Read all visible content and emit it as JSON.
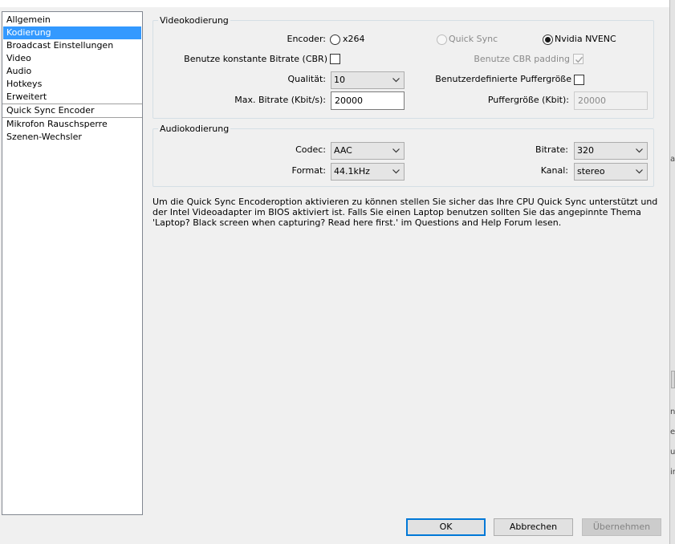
{
  "sidebar": {
    "items": [
      {
        "label": "Allgemein"
      },
      {
        "label": "Kodierung"
      },
      {
        "label": "Broadcast Einstellungen"
      },
      {
        "label": "Video"
      },
      {
        "label": "Audio"
      },
      {
        "label": "Hotkeys"
      },
      {
        "label": "Erweitert"
      },
      {
        "label": "Quick Sync Encoder"
      },
      {
        "label": "Mikrofon Rauschsperre"
      },
      {
        "label": "Szenen-Wechsler"
      }
    ],
    "selected_index": 1
  },
  "video": {
    "title": "Videokodierung",
    "encoder_label": "Encoder:",
    "encoder_options": [
      {
        "label": "x264",
        "selected": false,
        "enabled": true
      },
      {
        "label": "Quick Sync",
        "selected": false,
        "enabled": false
      },
      {
        "label": "Nvidia NVENC",
        "selected": true,
        "enabled": true
      }
    ],
    "cbr_label": "Benutze konstante Bitrate (CBR)",
    "cbr_padding_label": "Benutze CBR padding",
    "quality_label": "Qualität:",
    "quality_value": "10",
    "custom_buffer_label": "Benutzerdefinierte Puffergröße",
    "max_bitrate_label": "Max. Bitrate (Kbit/s):",
    "max_bitrate_value": "20000",
    "buffer_size_label": "Puffergröße (Kbit):",
    "buffer_size_value": "20000"
  },
  "audio": {
    "title": "Audiokodierung",
    "codec_label": "Codec:",
    "codec_value": "AAC",
    "bitrate_label": "Bitrate:",
    "bitrate_value": "320",
    "format_label": "Format:",
    "format_value": "44.1kHz",
    "channel_label": "Kanal:",
    "channel_value": "stereo"
  },
  "info_text": "Um die Quick Sync Encoderoption aktivieren zu können stellen Sie sicher das Ihre CPU Quick Sync unterstützt und der Intel Videoadapter im BIOS aktiviert ist. Falls Sie einen Laptop benutzen sollten Sie das angepinnte Thema 'Laptop? Black screen when capturing? Read here first.' im Questions and Help Forum lesen.",
  "buttons": {
    "ok": "OK",
    "cancel": "Abbrechen",
    "apply": "Übernehmen"
  },
  "edge_glyphs": {
    "a": "a",
    "n": "n",
    "e": "e",
    "u": "u",
    "ir": "ir"
  }
}
